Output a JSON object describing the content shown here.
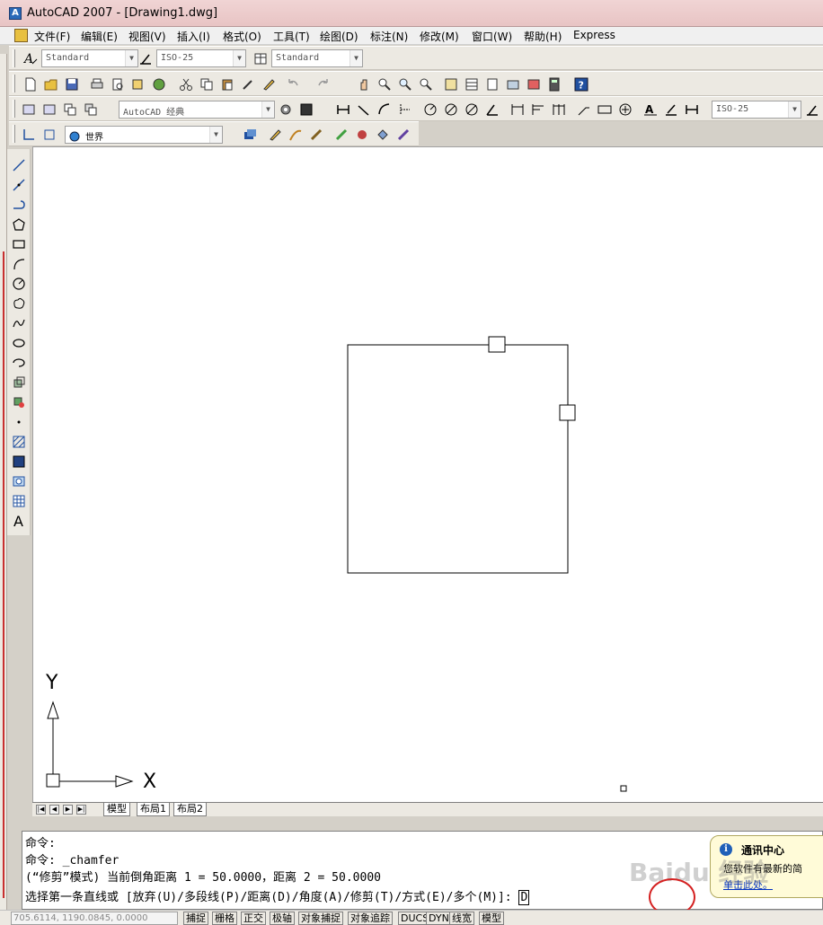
{
  "window": {
    "title": "AutoCAD 2007 - [Drawing1.dwg]"
  },
  "menu": [
    "文件(F)",
    "编辑(E)",
    "视图(V)",
    "插入(I)",
    "格式(O)",
    "工具(T)",
    "绘图(D)",
    "标注(N)",
    "修改(M)",
    "窗口(W)",
    "帮助(H)",
    "Express"
  ],
  "styles_toolbar": {
    "text_style": "Standard",
    "dim_style": "ISO-25",
    "table_style": "Standard"
  },
  "workspace_toolbar": {
    "workspace": "AutoCAD 经典"
  },
  "ucs_toolbar": {
    "ucs": "世界"
  },
  "dimension_toolbar": {
    "dim_style": "ISO-25"
  },
  "ucs_icon": {
    "y_label": "Y",
    "x_label": "X"
  },
  "layout_tabs": [
    "模型",
    "布局1",
    "布局2"
  ],
  "command_history": [
    "命令:",
    "命令: _chamfer",
    "(“修剪”模式) 当前倒角距离 1 = 50.0000，距离 2 = 50.0000"
  ],
  "command_prompt": "选择第一条直线或 [放弃(U)/多段线(P)/距离(D)/角度(A)/修剪(T)/方式(E)/多个(M)]:",
  "command_input": "D",
  "status": {
    "coordinates": "705.6114, 1190.0845, 0.0000",
    "toggles": [
      "捕捉",
      "栅格",
      "正交",
      "极轴",
      "对象捕捉",
      "对象追踪",
      "DUCS",
      "DYN",
      "线宽",
      "模型"
    ]
  },
  "comm_center": {
    "title": "通讯中心",
    "body": "您软件有最新的简",
    "link": "单击此处。"
  },
  "watermark": "Baidu 经验",
  "colors": {
    "title_bar": "#e8c4c4",
    "canvas": "#ffffff",
    "annotation_circle": "#d42020",
    "info_icon": "#2060b8"
  }
}
